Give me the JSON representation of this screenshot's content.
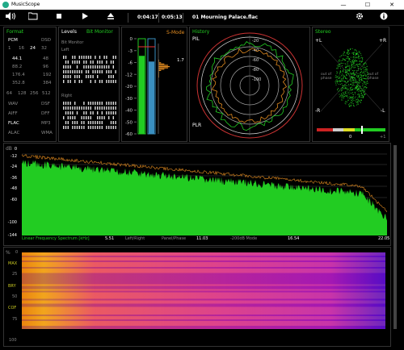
{
  "titlebar": {
    "app_title": "MusicScope",
    "minimize": "—",
    "maximize": "☐",
    "close": "✕"
  },
  "toolbar": {
    "elapsed": "0:04:17",
    "total": "0:05:13",
    "track": "01 Mourning Palace.flac"
  },
  "format": {
    "title": "Format",
    "pcm": "PCM",
    "dsd": "DSD",
    "bits": [
      "1",
      "16",
      "24",
      "32"
    ],
    "rates": [
      [
        "44.1",
        "48"
      ],
      [
        "88.2",
        "96"
      ],
      [
        "176.4",
        "192"
      ],
      [
        "352.8",
        "384"
      ]
    ],
    "dsd_rates": [
      "64",
      "128",
      "256",
      "512"
    ],
    "types": [
      [
        "WAV",
        "DSF"
      ],
      [
        "AIFF",
        "DFF"
      ],
      [
        "FLAC",
        "MP3"
      ],
      [
        "ALAC",
        "WMA"
      ]
    ]
  },
  "levels": {
    "title": "Levels",
    "bit_monitor_label": "Bit Monitor",
    "sub": "Bit Monitor",
    "left": "Left",
    "right": "Right"
  },
  "meter": {
    "smode": "S-Mode",
    "scale": [
      "0",
      "-3",
      "-6",
      "-12",
      "-20",
      "-30",
      "-40",
      "-50",
      "-60"
    ],
    "peak_value": "1.7",
    "lu_label": "LU",
    "left_level": 0.82,
    "right_level": 0.76
  },
  "history": {
    "title": "History",
    "pil": "PIL",
    "plr": "PLR",
    "rings": [
      "-20",
      "-40",
      "-60",
      "-80",
      "-100"
    ]
  },
  "stereo": {
    "title": "Stereo",
    "plus_l": "+L",
    "plus_r": "+R",
    "minus_l": "-L",
    "minus_r": "-R",
    "out_phase_left": "out of phase",
    "out_phase_right": "out of phase",
    "corr_min": "0",
    "corr_max": "+1"
  },
  "spectrum": {
    "db_label": "dB",
    "y_ticks": [
      "0",
      "-12",
      "-24",
      "-36",
      "-48",
      "-60",
      "-100",
      "-144"
    ],
    "x_ticks": [
      "5.51",
      "11.03",
      "16.54",
      "22.05"
    ],
    "mode_labels": [
      "Linear Frequency Spectrum [kHz]",
      "Left/Right",
      "Panel/Phase",
      "-200dB Mode"
    ]
  },
  "spectrogram": {
    "pct_label": "%",
    "y_ticks": [
      "0",
      "25",
      "50",
      "75",
      "100"
    ],
    "side_labels": [
      "MAX",
      "BRY",
      "COF"
    ]
  },
  "colors": {
    "accent_green": "#22cc22",
    "meter_blue": "#3a8fc0",
    "orange": "#e08a20"
  }
}
